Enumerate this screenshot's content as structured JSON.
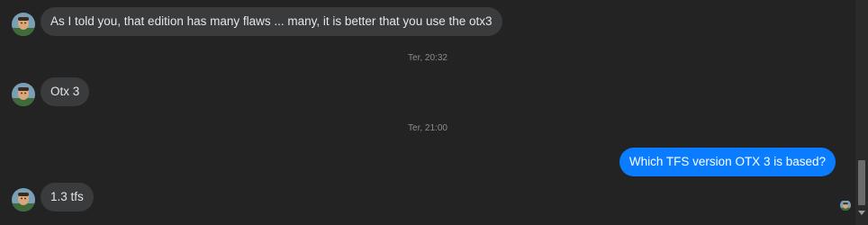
{
  "conversation": {
    "messages": [
      {
        "direction": "incoming",
        "text": "As I told you, that edition has many flaws ... many, it is better that you use the otx3"
      },
      {
        "direction": "incoming",
        "text": "Otx 3"
      },
      {
        "direction": "outgoing",
        "text": "Which TFS version OTX 3 is based?"
      },
      {
        "direction": "incoming",
        "text": "1.3 tfs"
      }
    ],
    "timestamps": [
      "Ter, 20:32",
      "Ter, 21:00"
    ]
  },
  "colors": {
    "background": "#232323",
    "incoming_bubble": "#3a3b3c",
    "outgoing_bubble": "#0a7cff",
    "timestamp_text": "#8a8d91"
  },
  "icons": {
    "avatar": "contact-avatar-icon",
    "seen": "seen-receipt-avatar-icon",
    "scroll_down": "scroll-down-arrow-icon"
  }
}
